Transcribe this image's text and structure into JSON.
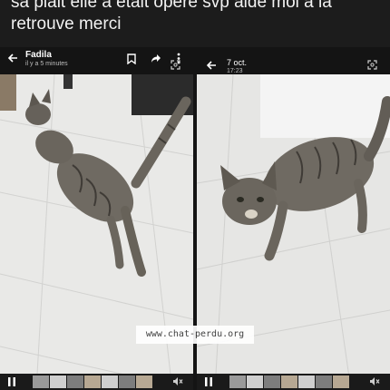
{
  "post": {
    "text_line1": "sa plait elle a était opéré svp aide moi a la",
    "text_line2": "retrouve merci"
  },
  "left_viewer": {
    "contact_name": "Fadila",
    "timestamp": "il y a 5 minutes",
    "icons": [
      "back-arrow-icon",
      "bookmark-icon",
      "share-icon",
      "more-icon",
      "scan-icon"
    ],
    "bottom_controls": [
      "pause-icon",
      "video-thumbnails",
      "mute-icon"
    ]
  },
  "right_viewer": {
    "date": "7 oct.",
    "time": "17:23",
    "icons": [
      "back-arrow-icon",
      "scan-icon"
    ],
    "bottom_controls": [
      "pause-icon",
      "video-thumbnails",
      "mute-icon"
    ]
  },
  "watermark": "www.chat-perdu.org",
  "colors": {
    "background": "#1c1c1c",
    "viewer_bar": "#141414",
    "floor": "#e8e8e6",
    "cat_fur": "#6f6a62",
    "text": "#f2f2f2"
  }
}
